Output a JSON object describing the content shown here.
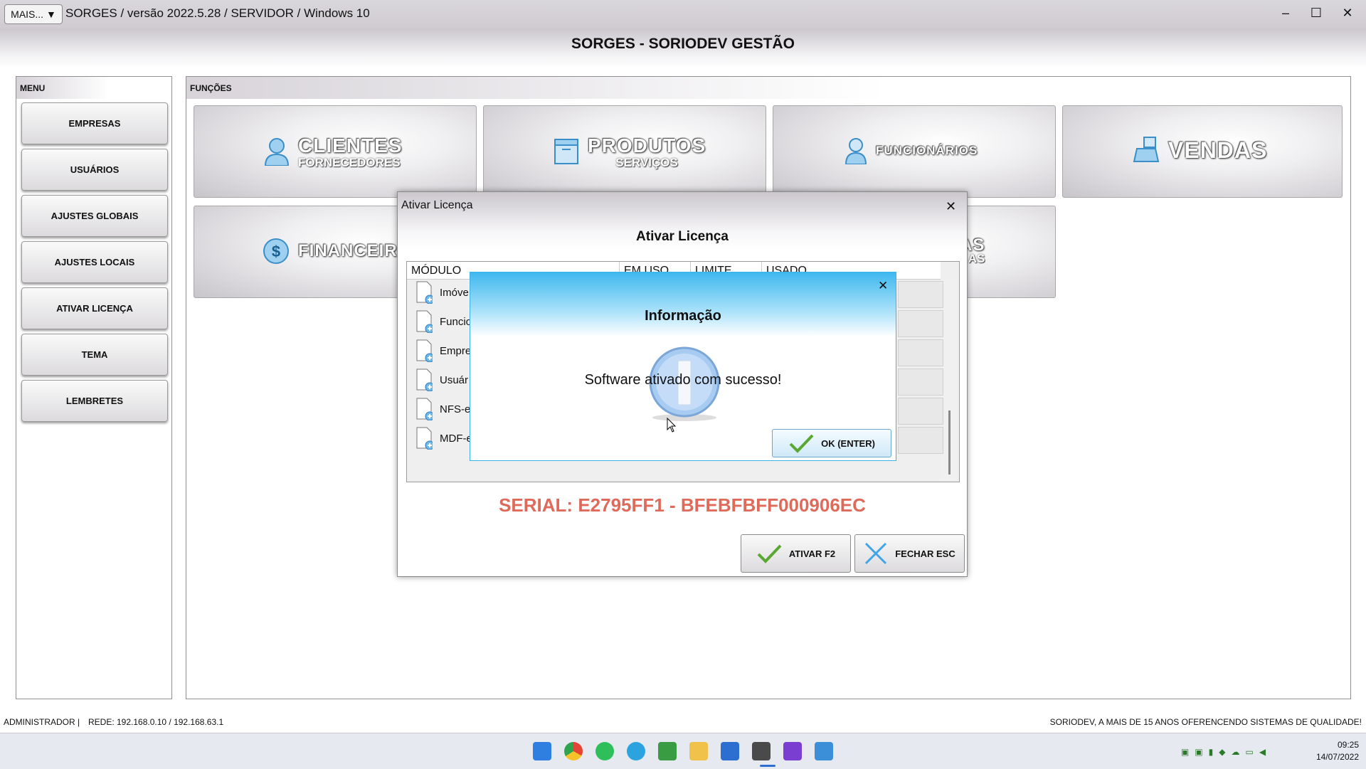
{
  "titlebar": {
    "mais_label": "MAIS... ▼",
    "title": "SORGES / versão 2022.5.28 / SERVIDOR / Windows 10",
    "minimize": "–",
    "maximize": "☐",
    "close": "✕"
  },
  "app_title": "SORGES - SORIODEV GESTÃO",
  "menu": {
    "heading": "MENU",
    "items": [
      "EMPRESAS",
      "USUÁRIOS",
      "AJUSTES GLOBAIS",
      "AJUSTES LOCAIS",
      "ATIVAR LICENÇA",
      "TEMA",
      "LEMBRETES"
    ]
  },
  "functions": {
    "heading": "FUNÇÕES",
    "tiles": [
      {
        "main": "CLIENTES",
        "sub": "FORNECEDORES",
        "icon": "person-icon"
      },
      {
        "main": "PRODUTOS",
        "sub": "SERVIÇOS",
        "icon": "box-icon"
      },
      {
        "main": "FUNCIONÁRIOS",
        "sub": "",
        "icon": "employee-icon"
      },
      {
        "main": "VENDAS",
        "sub": "",
        "icon": "register-icon"
      },
      {
        "main": "FINANCEIRO",
        "sub": "",
        "icon": "dollar-icon"
      },
      {
        "main": "AS",
        "sub": "AS",
        "icon": ""
      }
    ]
  },
  "license_dialog": {
    "window_title": "Ativar Licença",
    "heading": "Ativar Licença",
    "close": "✕",
    "columns": [
      "MÓDULO",
      "EM USO",
      "LIMITE",
      "USADO"
    ],
    "rows": [
      "Imóve",
      "Funcio",
      "Empre",
      "Usuár",
      "NFS-e",
      "MDF-e"
    ],
    "serial": "SERIAL: E2795FF1 - BFEBFBFF000906EC",
    "activate_button": "ATIVAR F2",
    "close_button": "FECHAR ESC"
  },
  "info_dialog": {
    "title": "Informação",
    "message": "Software ativado com sucesso!",
    "ok_button": "OK (ENTER)",
    "close": "✕"
  },
  "status_bar": {
    "left": "ADMINISTRADOR |",
    "network": "REDE: 192.168.0.10 / 192.168.63.1",
    "right": "SORIODEV, A MAIS DE 15 ANOS OFERENCENDO SISTEMAS DE QUALIDADE!"
  },
  "taskbar": {
    "time": "09:25",
    "date": "14/07/2022"
  },
  "colors": {
    "serial_red": "#e06a5a",
    "info_blue": "#3fb8ee",
    "check_green": "#5aa832"
  }
}
